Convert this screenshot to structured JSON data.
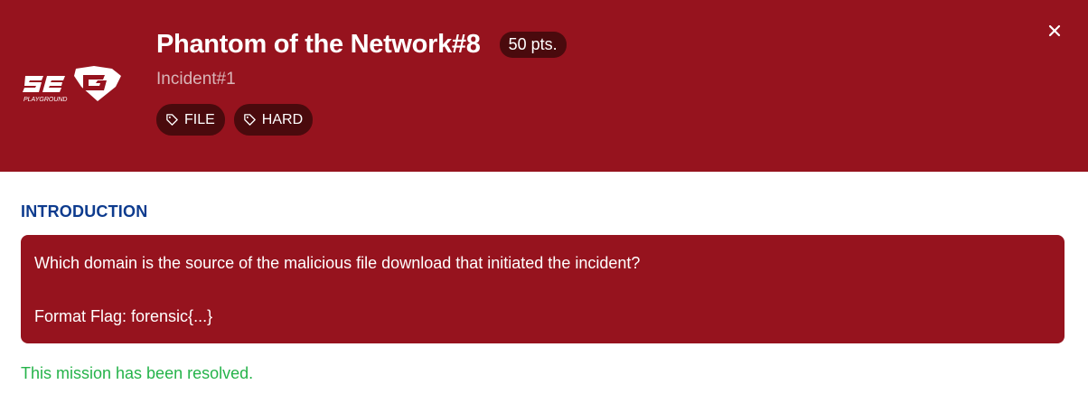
{
  "challenge": {
    "title": "Phantom of the Network#8",
    "points": "50 pts.",
    "category": "Incident#1",
    "tags": [
      {
        "icon": "tag-icon",
        "label": "FILE"
      },
      {
        "icon": "tag-icon",
        "label": "HARD"
      }
    ]
  },
  "logo": {
    "text": "SEG",
    "subtext": "PLAYGROUND"
  },
  "close_icon": "close-icon",
  "introduction": {
    "heading": "INTRODUCTION",
    "question": "Which domain is the source of the malicious file download that initiated the incident?",
    "format": "Format Flag: forensic{...}"
  },
  "status": {
    "text": "This mission has been resolved."
  },
  "colors": {
    "header_bg": "#96131e",
    "badge_bg": "#4a0a0d",
    "heading": "#0d3b8e",
    "success": "#25b34a"
  }
}
